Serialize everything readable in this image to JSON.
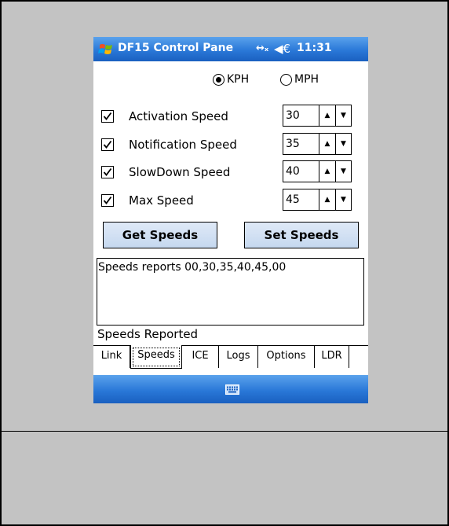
{
  "titlebar": {
    "title": "DF15 Control Pane",
    "connectivity_icon": "connectivity-icon",
    "speaker_icon": "speaker-icon",
    "speaker_glyph": "◀€",
    "connectivity_glyph": "↔ₓ",
    "clock": "11:31"
  },
  "units": {
    "options": [
      {
        "label": "KPH",
        "selected": true
      },
      {
        "label": "MPH",
        "selected": false
      }
    ]
  },
  "speeds": [
    {
      "label": "Activation Speed",
      "checked": true,
      "value": "30"
    },
    {
      "label": "Notification Speed",
      "checked": true,
      "value": "35"
    },
    {
      "label": "SlowDown Speed",
      "checked": true,
      "value": "40"
    },
    {
      "label": "Max Speed",
      "checked": true,
      "value": "45"
    }
  ],
  "spinner": {
    "up": "▲",
    "down": "▼"
  },
  "buttons": {
    "get_speeds": "Get Speeds",
    "set_speeds": "Set Speeds"
  },
  "output": {
    "text": "Speeds reports 00,30,35,40,45,00"
  },
  "status": "Speeds Reported",
  "tabs": [
    {
      "label": "Link",
      "active": false
    },
    {
      "label": "Speeds",
      "active": true
    },
    {
      "label": "ICE",
      "active": false
    },
    {
      "label": "Logs",
      "active": false
    },
    {
      "label": "Options",
      "active": false
    },
    {
      "label": "LDR",
      "active": false
    }
  ],
  "colors": {
    "titlebar": "#2a78d8",
    "page_background": "#c3c3c3",
    "button": "#c5d8ef"
  },
  "icons": {
    "start": "windows-flag-icon",
    "keyboard": "keyboard-icon"
  }
}
